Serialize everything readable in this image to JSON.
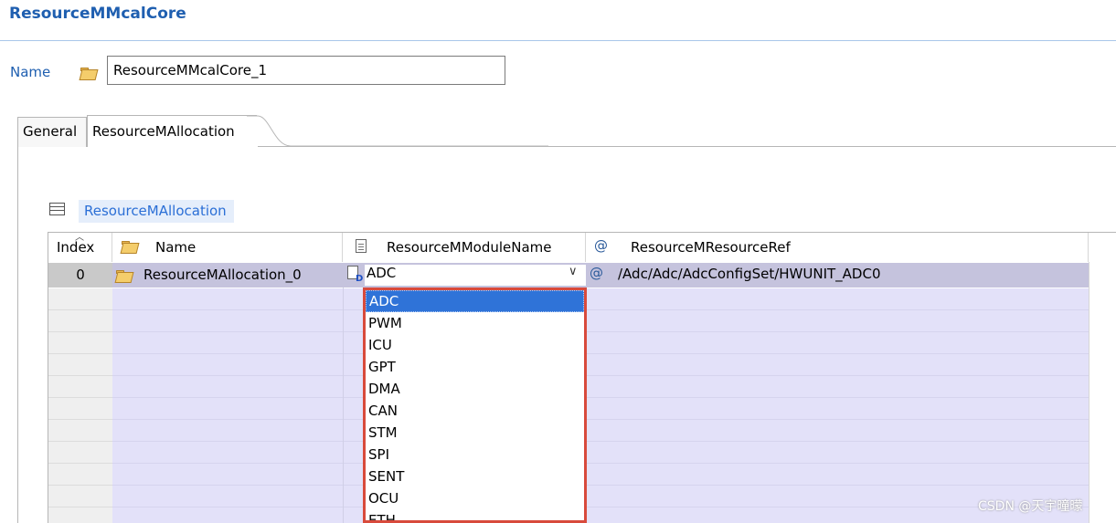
{
  "page": {
    "title": "ResourceMMcalCore",
    "name_label": "Name",
    "name_value": "ResourceMMcalCore_1"
  },
  "tabs": [
    {
      "label": "General",
      "active": false
    },
    {
      "label": "ResourceMAllocation",
      "active": true
    }
  ],
  "section": {
    "label": "ResourceMAllocation"
  },
  "table": {
    "columns": [
      "Index",
      "Name",
      "ResourceMModuleName",
      "ResourceMResourceRef"
    ],
    "rows": [
      {
        "index": "0",
        "name": "ResourceMAllocation_0",
        "module": "ADC",
        "ref": "/Adc/Adc/AdcConfigSet/HWUNIT_ADC0"
      }
    ]
  },
  "dropdown": {
    "options": [
      "ADC",
      "PWM",
      "ICU",
      "GPT",
      "DMA",
      "CAN",
      "STM",
      "SPI",
      "SENT",
      "OCU",
      "ETH"
    ],
    "selected": "ADC",
    "highlight_color": "#d84a3c"
  },
  "watermark": "CSDN @天宇曈曚",
  "colors": {
    "title": "#1f5fb0",
    "selection": "#2f73d8",
    "row_selected": "#c5c3dd",
    "row_body": "#e3e1f9"
  },
  "icons": {
    "folder": "folder-open-icon",
    "table": "table-icon",
    "document": "document-icon",
    "reference": "at-reference-icon",
    "chevron": "chevron-down-icon",
    "sort": "sort-up-icon"
  }
}
